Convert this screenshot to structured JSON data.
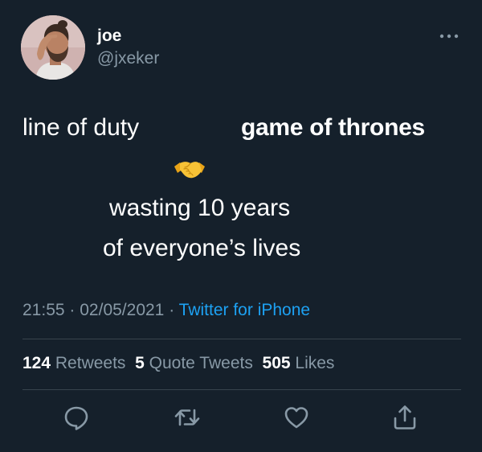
{
  "author": {
    "display_name": "joe",
    "username": "@jxeker"
  },
  "tweet": {
    "left_text": "line of duty",
    "right_text": "game of thrones",
    "emoji": "🤝",
    "line_one": "wasting 10 years",
    "line_two": "of everyone’s lives"
  },
  "meta": {
    "time": "21:55",
    "separator": "·",
    "date": "02/05/2021",
    "source": "Twitter for iPhone"
  },
  "stats": {
    "retweets_count": "124",
    "retweets_label": "Retweets",
    "quotes_count": "5",
    "quotes_label": "Quote Tweets",
    "likes_count": "505",
    "likes_label": "Likes"
  },
  "icons": {
    "more": "more-dots-icon",
    "reply": "reply-icon",
    "retweet": "retweet-icon",
    "like": "heart-icon",
    "share": "share-icon"
  },
  "colors": {
    "background": "#15202b",
    "secondary_text": "#8899a6",
    "link": "#1da1f2",
    "divider": "#38444d"
  }
}
